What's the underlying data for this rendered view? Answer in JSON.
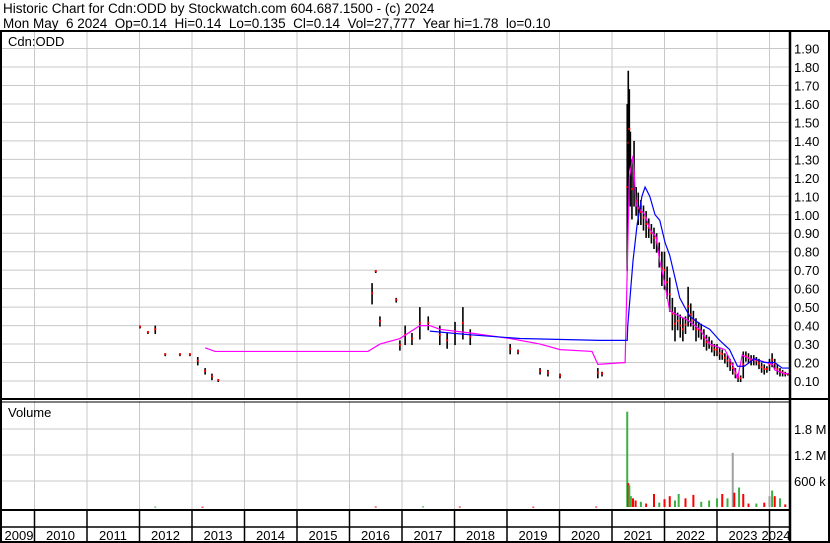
{
  "header": {
    "line1": "Historic Chart for Cdn:ODD by Stockwatch.com 604.687.1500 - (c) 2024",
    "line2": "Mon May  6 2024  Op=0.14  Hi=0.14  Lo=0.135  Cl=0.14  Vol=27,777  Year hi=1.78  lo=0.10"
  },
  "colors": {
    "bar": "#000000",
    "tick": "#ff0000",
    "ma_short": "#ff00ff",
    "ma_long": "#0000ff",
    "vol_up": "#3cb043",
    "vol_down": "#ff0000",
    "vol_flat": "#a0a0a0",
    "grid": "#c8c8c8"
  },
  "chart_data": [
    {
      "type": "line",
      "title": "Cdn:ODD",
      "ylim": [
        0.05,
        1.95
      ],
      "y_ticks": [
        "0.10",
        "0.20",
        "0.30",
        "0.40",
        "0.50",
        "0.60",
        "0.70",
        "0.80",
        "0.90",
        "1.00",
        "1.10",
        "1.20",
        "1.30",
        "1.40",
        "1.50",
        "1.60",
        "1.70",
        "1.80",
        "1.90"
      ],
      "x_ticks": [
        "2009",
        "2010",
        "2011",
        "2012",
        "2013",
        "2014",
        "2015",
        "2016",
        "2017",
        "2018",
        "2019",
        "2020",
        "2021",
        "2022",
        "2023",
        "2024"
      ],
      "xlim": [
        2009.37,
        2024.37
      ],
      "grid": true,
      "bars_hi_lo": [
        [
          2012.01,
          0.4,
          0.39
        ],
        [
          2012.16,
          0.37,
          0.36
        ],
        [
          2012.3,
          0.4,
          0.36
        ],
        [
          2012.49,
          0.25,
          0.24
        ],
        [
          2012.77,
          0.25,
          0.24
        ],
        [
          2012.96,
          0.25,
          0.24
        ],
        [
          2013.11,
          0.23,
          0.19
        ],
        [
          2013.25,
          0.17,
          0.14
        ],
        [
          2013.38,
          0.14,
          0.11
        ],
        [
          2013.5,
          0.11,
          0.1
        ],
        [
          2016.43,
          0.63,
          0.52
        ],
        [
          2016.5,
          0.7,
          0.69
        ],
        [
          2016.58,
          0.45,
          0.4
        ],
        [
          2016.89,
          0.55,
          0.53
        ],
        [
          2016.96,
          0.32,
          0.27
        ],
        [
          2017.06,
          0.4,
          0.3
        ],
        [
          2017.19,
          0.36,
          0.3
        ],
        [
          2017.34,
          0.5,
          0.33
        ],
        [
          2017.5,
          0.45,
          0.38
        ],
        [
          2017.72,
          0.4,
          0.3
        ],
        [
          2017.86,
          0.36,
          0.28
        ],
        [
          2018.01,
          0.42,
          0.3
        ],
        [
          2018.16,
          0.5,
          0.33
        ],
        [
          2018.3,
          0.38,
          0.3
        ],
        [
          2019.06,
          0.3,
          0.25
        ],
        [
          2019.21,
          0.27,
          0.25
        ],
        [
          2019.63,
          0.17,
          0.14
        ],
        [
          2019.78,
          0.16,
          0.13
        ],
        [
          2020.01,
          0.14,
          0.12
        ],
        [
          2020.73,
          0.17,
          0.12
        ],
        [
          2020.81,
          0.15,
          0.13
        ],
        [
          2021.29,
          1.6,
          0.7
        ],
        [
          2021.31,
          1.78,
          1.0
        ],
        [
          2021.33,
          1.68,
          1.25
        ],
        [
          2021.35,
          1.45,
          1.05
        ],
        [
          2021.38,
          1.3,
          0.98
        ],
        [
          2021.42,
          1.4,
          1.05
        ],
        [
          2021.46,
          1.15,
          1.0
        ],
        [
          2021.5,
          1.12,
          0.95
        ],
        [
          2021.55,
          1.08,
          0.95
        ],
        [
          2021.6,
          1.05,
          0.92
        ],
        [
          2021.65,
          1.02,
          0.88
        ],
        [
          2021.7,
          0.98,
          0.88
        ],
        [
          2021.75,
          0.95,
          0.85
        ],
        [
          2021.8,
          0.93,
          0.82
        ],
        [
          2021.85,
          0.9,
          0.8
        ],
        [
          2021.9,
          0.85,
          0.72
        ],
        [
          2021.95,
          0.8,
          0.62
        ],
        [
          2022.0,
          0.8,
          0.6
        ],
        [
          2022.05,
          0.72,
          0.55
        ],
        [
          2022.1,
          0.66,
          0.48
        ],
        [
          2022.15,
          0.55,
          0.38
        ],
        [
          2022.2,
          0.5,
          0.32
        ],
        [
          2022.25,
          0.47,
          0.38
        ],
        [
          2022.3,
          0.46,
          0.34
        ],
        [
          2022.35,
          0.44,
          0.32
        ],
        [
          2022.4,
          0.45,
          0.36
        ],
        [
          2022.45,
          0.61,
          0.4
        ],
        [
          2022.5,
          0.52,
          0.4
        ],
        [
          2022.55,
          0.48,
          0.38
        ],
        [
          2022.6,
          0.44,
          0.32
        ],
        [
          2022.65,
          0.42,
          0.34
        ],
        [
          2022.7,
          0.41,
          0.33
        ],
        [
          2022.75,
          0.38,
          0.29
        ],
        [
          2022.8,
          0.35,
          0.27
        ],
        [
          2022.85,
          0.34,
          0.28
        ],
        [
          2022.9,
          0.32,
          0.26
        ],
        [
          2022.95,
          0.3,
          0.24
        ],
        [
          2023.0,
          0.3,
          0.24
        ],
        [
          2023.05,
          0.28,
          0.22
        ],
        [
          2023.1,
          0.27,
          0.22
        ],
        [
          2023.15,
          0.25,
          0.2
        ],
        [
          2023.2,
          0.24,
          0.18
        ],
        [
          2023.25,
          0.22,
          0.16
        ],
        [
          2023.3,
          0.2,
          0.14
        ],
        [
          2023.35,
          0.17,
          0.12
        ],
        [
          2023.4,
          0.14,
          0.1
        ],
        [
          2023.45,
          0.13,
          0.1
        ],
        [
          2023.5,
          0.26,
          0.12
        ],
        [
          2023.55,
          0.26,
          0.21
        ],
        [
          2023.6,
          0.25,
          0.2
        ],
        [
          2023.65,
          0.24,
          0.19
        ],
        [
          2023.7,
          0.24,
          0.19
        ],
        [
          2023.75,
          0.23,
          0.19
        ],
        [
          2023.8,
          0.22,
          0.17
        ],
        [
          2023.85,
          0.2,
          0.15
        ],
        [
          2023.9,
          0.19,
          0.14
        ],
        [
          2023.95,
          0.18,
          0.15
        ],
        [
          2024.0,
          0.22,
          0.16
        ],
        [
          2024.05,
          0.25,
          0.18
        ],
        [
          2024.1,
          0.22,
          0.17
        ],
        [
          2024.15,
          0.19,
          0.14
        ],
        [
          2024.2,
          0.17,
          0.13
        ],
        [
          2024.25,
          0.16,
          0.13
        ],
        [
          2024.3,
          0.15,
          0.13
        ],
        [
          2024.35,
          0.14,
          0.135
        ]
      ],
      "series": [
        {
          "name": "short moving average",
          "color_key": "ma_short",
          "points": [
            [
              2013.25,
              0.28
            ],
            [
              2013.44,
              0.26
            ],
            [
              2016.35,
              0.26
            ],
            [
              2016.58,
              0.3
            ],
            [
              2016.96,
              0.33
            ],
            [
              2017.34,
              0.4
            ],
            [
              2017.53,
              0.4
            ],
            [
              2017.72,
              0.38
            ],
            [
              2018.3,
              0.36
            ],
            [
              2019.06,
              0.33
            ],
            [
              2019.63,
              0.3
            ],
            [
              2020.01,
              0.27
            ],
            [
              2020.62,
              0.26
            ],
            [
              2020.73,
              0.19
            ],
            [
              2021.25,
              0.2
            ],
            [
              2021.29,
              0.7
            ],
            [
              2021.33,
              1.2
            ],
            [
              2021.4,
              1.32
            ],
            [
              2021.46,
              1.05
            ],
            [
              2021.63,
              1.0
            ],
            [
              2021.72,
              0.92
            ],
            [
              2021.84,
              0.88
            ],
            [
              2021.91,
              0.75
            ],
            [
              2022.01,
              0.62
            ],
            [
              2022.1,
              0.48
            ],
            [
              2022.29,
              0.45
            ],
            [
              2022.44,
              0.43
            ],
            [
              2022.67,
              0.38
            ],
            [
              2022.86,
              0.3
            ],
            [
              2023.15,
              0.27
            ],
            [
              2023.31,
              0.18
            ],
            [
              2023.39,
              0.11
            ],
            [
              2023.48,
              0.24
            ],
            [
              2023.63,
              0.22
            ],
            [
              2023.82,
              0.21
            ],
            [
              2024.06,
              0.19
            ],
            [
              2024.1,
              0.16
            ],
            [
              2024.29,
              0.14
            ],
            [
              2024.37,
              0.14
            ]
          ]
        },
        {
          "name": "long moving average",
          "color_key": "ma_long",
          "points": [
            [
              2017.53,
              0.37
            ],
            [
              2018.3,
              0.35
            ],
            [
              2019.25,
              0.33
            ],
            [
              2020.77,
              0.32
            ],
            [
              2021.29,
              0.32
            ],
            [
              2021.3,
              0.4
            ],
            [
              2021.4,
              0.75
            ],
            [
              2021.48,
              0.95
            ],
            [
              2021.57,
              1.1
            ],
            [
              2021.63,
              1.15
            ],
            [
              2021.72,
              1.1
            ],
            [
              2021.82,
              1.0
            ],
            [
              2021.91,
              0.97
            ],
            [
              2022.01,
              0.85
            ],
            [
              2022.1,
              0.78
            ],
            [
              2022.29,
              0.55
            ],
            [
              2022.48,
              0.45
            ],
            [
              2022.67,
              0.41
            ],
            [
              2022.86,
              0.38
            ],
            [
              2023.05,
              0.32
            ],
            [
              2023.24,
              0.27
            ],
            [
              2023.39,
              0.18
            ],
            [
              2023.52,
              0.18
            ],
            [
              2023.71,
              0.22
            ],
            [
              2023.91,
              0.2
            ],
            [
              2024.1,
              0.2
            ],
            [
              2024.24,
              0.17
            ],
            [
              2024.37,
              0.17
            ]
          ]
        }
      ]
    },
    {
      "type": "bar",
      "title": "Volume",
      "y_ticks": [
        "600 k",
        "1.2 M",
        "1.8 M"
      ],
      "ylim": [
        0,
        2400000
      ],
      "bars": [
        [
          2012.3,
          10000,
          "up"
        ],
        [
          2013.2,
          8000,
          "down"
        ],
        [
          2016.5,
          12000,
          "down"
        ],
        [
          2017.4,
          15000,
          "up"
        ],
        [
          2018.1,
          10000,
          "down"
        ],
        [
          2019.5,
          8000,
          "down"
        ],
        [
          2020.7,
          10000,
          "down"
        ],
        [
          2021.29,
          2200000,
          "up"
        ],
        [
          2021.31,
          550000,
          "down"
        ],
        [
          2021.33,
          500000,
          "up"
        ],
        [
          2021.36,
          250000,
          "up"
        ],
        [
          2021.4,
          200000,
          "down"
        ],
        [
          2021.45,
          150000,
          "down"
        ],
        [
          2021.55,
          120000,
          "up"
        ],
        [
          2021.65,
          80000,
          "down"
        ],
        [
          2021.8,
          300000,
          "down"
        ],
        [
          2021.9,
          100000,
          "up"
        ],
        [
          2022.0,
          180000,
          "down"
        ],
        [
          2022.1,
          250000,
          "down"
        ],
        [
          2022.2,
          150000,
          "up"
        ],
        [
          2022.27,
          300000,
          "up"
        ],
        [
          2022.4,
          200000,
          "down"
        ],
        [
          2022.55,
          280000,
          "down"
        ],
        [
          2022.7,
          120000,
          "up"
        ],
        [
          2022.85,
          150000,
          "up"
        ],
        [
          2023.0,
          200000,
          "up"
        ],
        [
          2023.1,
          300000,
          "down"
        ],
        [
          2023.2,
          200000,
          "up"
        ],
        [
          2023.3,
          1250000,
          "flat"
        ],
        [
          2023.33,
          330000,
          "down"
        ],
        [
          2023.42,
          450000,
          "up"
        ],
        [
          2023.5,
          300000,
          "down"
        ],
        [
          2023.6,
          80000,
          "down"
        ],
        [
          2023.75,
          80000,
          "up"
        ],
        [
          2023.9,
          100000,
          "down"
        ],
        [
          2024.0,
          250000,
          "flat"
        ],
        [
          2024.05,
          380000,
          "up"
        ],
        [
          2024.1,
          250000,
          "down"
        ],
        [
          2024.2,
          200000,
          "up"
        ],
        [
          2024.3,
          60000,
          "down"
        ]
      ]
    }
  ]
}
